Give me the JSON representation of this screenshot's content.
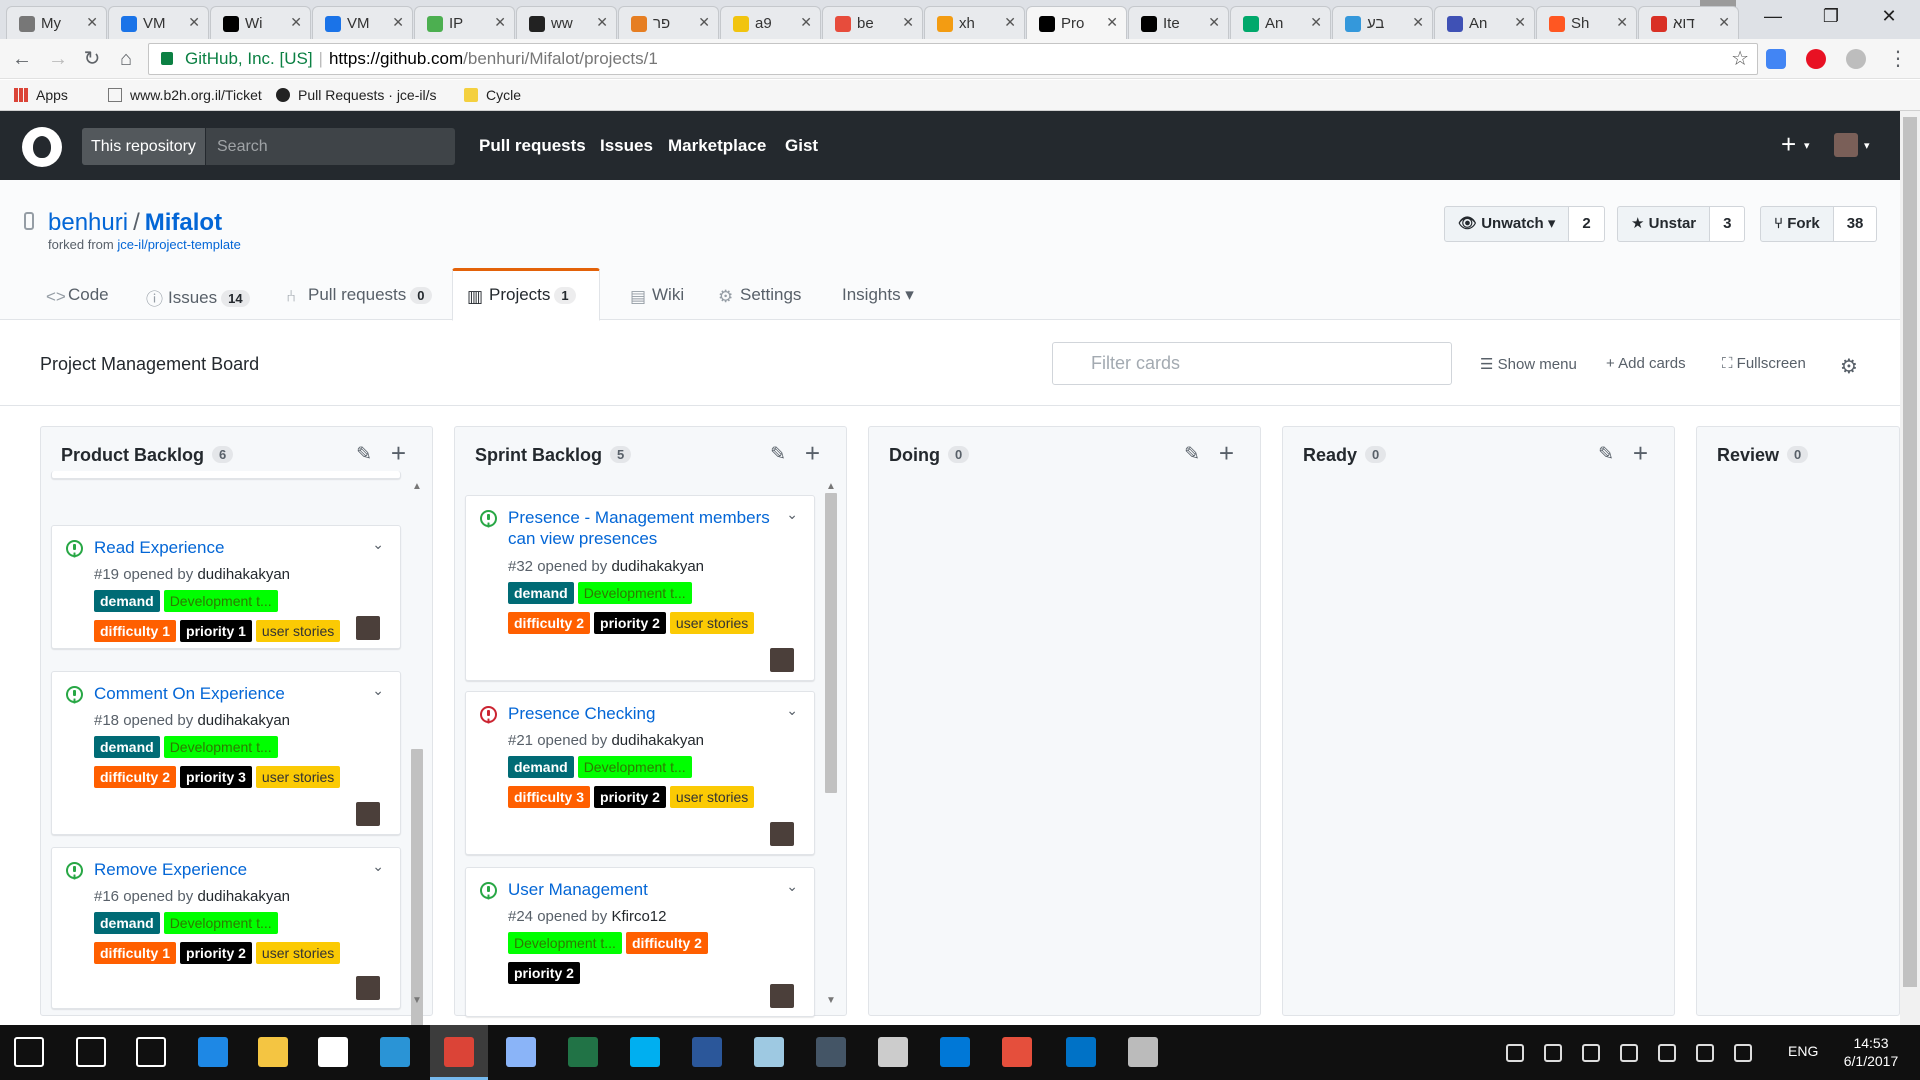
{
  "browser": {
    "tabs": [
      {
        "label": "My",
        "color": "#777777"
      },
      {
        "label": "VM",
        "color": "#1a73e8"
      },
      {
        "label": "Wi",
        "color": "#000000"
      },
      {
        "label": "VM",
        "color": "#1a73e8"
      },
      {
        "label": "IP",
        "color": "#4caf50"
      },
      {
        "label": "ww",
        "color": "#222222"
      },
      {
        "label": "פר",
        "color": "#e67e22"
      },
      {
        "label": "a9",
        "color": "#f1c40f"
      },
      {
        "label": "be",
        "color": "#e74c3c"
      },
      {
        "label": "xh",
        "color": "#f39c12"
      },
      {
        "label": "Pro",
        "color": "#000000"
      },
      {
        "label": "Ite",
        "color": "#000000"
      },
      {
        "label": "An",
        "color": "#00a86b"
      },
      {
        "label": "בע",
        "color": "#3498db"
      },
      {
        "label": "An",
        "color": "#3f51b5"
      },
      {
        "label": "Sh",
        "color": "#ff5722"
      },
      {
        "label": "דוא",
        "color": "#d93025"
      }
    ],
    "active_tab_index": 10,
    "tab_close": "✕",
    "window_controls": {
      "minimize": "—",
      "restore": "❐",
      "close": "✕"
    },
    "nav": {
      "back": "←",
      "forward": "→",
      "reload": "↻",
      "home": "⌂"
    },
    "url": {
      "ev_name": "GitHub, Inc. [US]",
      "separator": "|",
      "scheme_host": "https://github.com",
      "path": "/benhuri/Mifalot/projects/1"
    },
    "star": "☆",
    "menu": "⋮",
    "bookmarks": [
      {
        "label": "Apps",
        "icon": "apps-grid-icon"
      },
      {
        "label": "www.b2h.org.il/Ticket",
        "icon": "page-icon"
      },
      {
        "label": "Pull Requests · jce-il/s",
        "icon": "github-icon"
      },
      {
        "label": "Cycle",
        "icon": "folder-icon"
      }
    ]
  },
  "github": {
    "scope": "This repository",
    "search_placeholder": "Search",
    "nav": [
      "Pull requests",
      "Issues",
      "Marketplace",
      "Gist"
    ],
    "plus": "+",
    "caret": "▾",
    "repo": {
      "owner": "benhuri",
      "slash": "/",
      "name": "Mifalot",
      "forked_prefix": "forked from ",
      "forked_from": "jce-il/project-template"
    },
    "actions": [
      {
        "label": "Unwatch ▾",
        "count": "2",
        "icon": "👁"
      },
      {
        "label": "Unstar",
        "count": "3",
        "icon": "★"
      },
      {
        "label": "Fork",
        "count": "38",
        "icon": "⑂"
      }
    ],
    "tabs": [
      {
        "label": "Code",
        "icon": "<>",
        "count": ""
      },
      {
        "label": "Issues",
        "icon": "ⓘ",
        "count": "14"
      },
      {
        "label": "Pull requests",
        "icon": "⑃",
        "count": "0"
      },
      {
        "label": "Projects",
        "icon": "▥",
        "count": "1"
      },
      {
        "label": "Wiki",
        "icon": "▤",
        "count": ""
      },
      {
        "label": "Settings",
        "icon": "⚙",
        "count": ""
      },
      {
        "label": "Insights ▾",
        "icon": "",
        "count": ""
      }
    ]
  },
  "project": {
    "name": "Project Management Board",
    "filter_placeholder": "Filter cards",
    "buttons": {
      "show_menu": "☰ Show menu",
      "add_cards": "+ Add cards",
      "fullscreen": "⛶ Fullscreen"
    },
    "gear": "⚙",
    "pencil": "✎",
    "col_plus": "+",
    "chevron": "⌄",
    "opened_by": "opened by",
    "columns": [
      {
        "name": "Product Backlog",
        "count": "6",
        "cards": [
          {
            "title": "Read Experience",
            "number": "#19",
            "author": "dudihakakyan",
            "state": "open",
            "labels": [
              [
                "demand",
                "demand"
              ],
              [
                "Development t...",
                "dev"
              ],
              [
                "difficulty 1",
                "diff"
              ],
              [
                "priority 1",
                "prio"
              ],
              [
                "user stories",
                "us"
              ]
            ]
          },
          {
            "title": "Comment On Experience",
            "number": "#18",
            "author": "dudihakakyan",
            "state": "open",
            "labels": [
              [
                "demand",
                "demand"
              ],
              [
                "Development t...",
                "dev"
              ],
              [
                "difficulty 2",
                "diff"
              ],
              [
                "priority 3",
                "prio"
              ],
              [
                "user stories",
                "us"
              ]
            ]
          },
          {
            "title": "Remove Experience",
            "number": "#16",
            "author": "dudihakakyan",
            "state": "open",
            "labels": [
              [
                "demand",
                "demand"
              ],
              [
                "Development t...",
                "dev"
              ],
              [
                "difficulty 1",
                "diff"
              ],
              [
                "priority 2",
                "prio"
              ],
              [
                "user stories",
                "us"
              ]
            ]
          }
        ]
      },
      {
        "name": "Sprint Backlog",
        "count": "5",
        "cards": [
          {
            "title": "Presence - Management members can view presences",
            "number": "#32",
            "author": "dudihakakyan",
            "state": "open",
            "labels": [
              [
                "demand",
                "demand"
              ],
              [
                "Development t...",
                "dev"
              ],
              [
                "difficulty 2",
                "diff"
              ],
              [
                "priority 2",
                "prio"
              ],
              [
                "user stories",
                "us"
              ]
            ]
          },
          {
            "title": "Presence Checking",
            "number": "#21",
            "author": "dudihakakyan",
            "state": "closed",
            "labels": [
              [
                "demand",
                "demand"
              ],
              [
                "Development t...",
                "dev"
              ],
              [
                "difficulty 3",
                "diff"
              ],
              [
                "priority 2",
                "prio"
              ],
              [
                "user stories",
                "us"
              ]
            ]
          },
          {
            "title": "User Management",
            "number": "#24",
            "author": "Kfirco12",
            "state": "open",
            "labels": [
              [
                "Development t...",
                "dev"
              ],
              [
                "difficulty 2",
                "diff"
              ],
              [
                "priority 2",
                "prio"
              ]
            ]
          }
        ]
      },
      {
        "name": "Doing",
        "count": "0",
        "cards": []
      },
      {
        "name": "Ready",
        "count": "0",
        "cards": []
      },
      {
        "name": "Review",
        "count": "0",
        "cards": []
      }
    ]
  },
  "taskbar": {
    "tray_lang": "ENG",
    "time": "14:53",
    "date": "6/1/2017"
  }
}
